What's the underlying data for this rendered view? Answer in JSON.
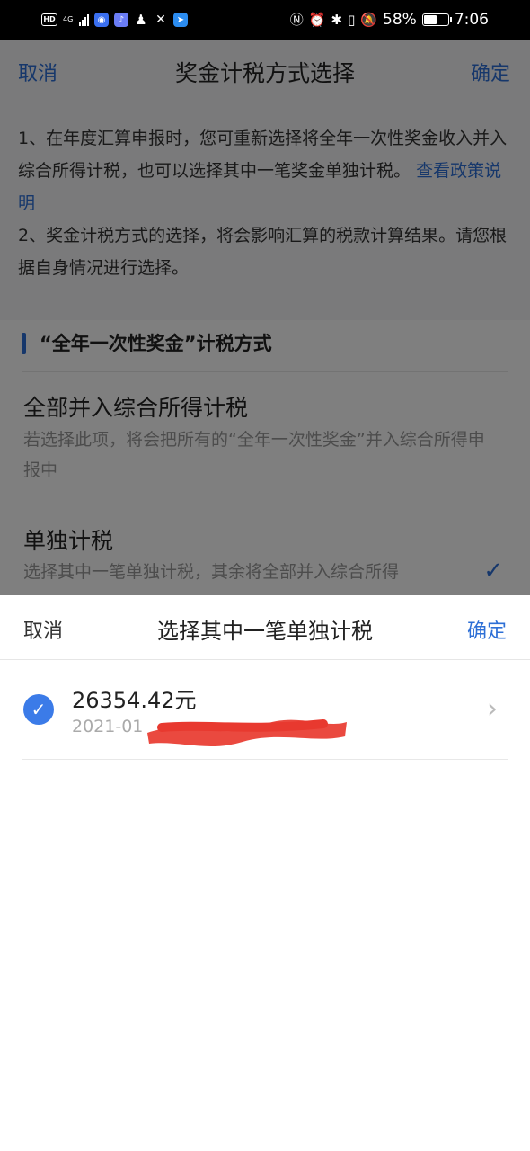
{
  "status_bar": {
    "hd_label": "HD",
    "network": "4G",
    "battery_percent": "58%",
    "battery_level": 0.58,
    "time": "7:06"
  },
  "page": {
    "cancel": "取消",
    "title": "奖金计税方式选择",
    "confirm": "确定",
    "info_line1": "1、在年度汇算申报时，您可重新选择将全年一次性奖金收入并入综合所得计税，也可以选择其中一笔奖金单独计税。",
    "policy_link": "查看政策说明",
    "info_line2": "2、奖金计税方式的选择，将会影响汇算的税款计算结果。请您根据自身情况进行选择。",
    "section_title": "“全年一次性奖金”计税方式",
    "option1_title": "全部并入综合所得计税",
    "option1_desc": "若选择此项，将会把所有的“全年一次性奖金”并入综合所得申报中",
    "option2_title": "单独计税",
    "option2_desc": "选择其中一笔单独计税，其余将全部并入综合所得"
  },
  "sheet": {
    "cancel": "取消",
    "title": "选择其中一笔单独计税",
    "confirm": "确定",
    "items": [
      {
        "amount": "26354.42元",
        "date": "2021-01"
      }
    ]
  },
  "colors": {
    "accent": "#2d6fd6",
    "redaction": "#e8392f"
  }
}
